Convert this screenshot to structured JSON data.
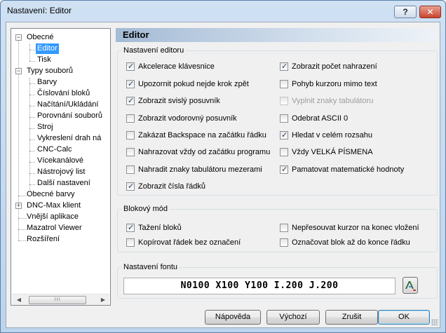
{
  "window": {
    "title": "Nastavení: Editor",
    "help_label": "?",
    "close_label": "✕"
  },
  "tree": {
    "items": [
      {
        "label": "Obecné"
      },
      {
        "label": "Editor"
      },
      {
        "label": "Tisk"
      },
      {
        "label": "Typy souborů"
      },
      {
        "label": "Barvy"
      },
      {
        "label": "Číslování bloků"
      },
      {
        "label": "Načítání/Ukládání"
      },
      {
        "label": "Porovnání souborů"
      },
      {
        "label": "Stroj"
      },
      {
        "label": "Vykreslení drah ná"
      },
      {
        "label": "CNC-Calc"
      },
      {
        "label": "Vícekanálové"
      },
      {
        "label": "Nástrojový list"
      },
      {
        "label": "Další nastavení"
      },
      {
        "label": "Obecné barvy"
      },
      {
        "label": "DNC-Max klient"
      },
      {
        "label": "Vnější aplikace"
      },
      {
        "label": "Mazatrol Viewer"
      },
      {
        "label": "Rozšíření"
      }
    ],
    "expander_minus": "−",
    "expander_plus": "+",
    "scroll_left": "◀",
    "scroll_right": "▶",
    "scroll_grip": "III"
  },
  "panel": {
    "title": "Editor"
  },
  "editor_settings": {
    "title": "Nastavení editoru",
    "left": [
      {
        "label": "Akcelerace klávesnice",
        "checked": true
      },
      {
        "label": "Upozornit pokud nejde krok zpět",
        "checked": true
      },
      {
        "label": "Zobrazit svislý posuvník",
        "checked": true
      },
      {
        "label": "Zobrazit vodorovný posuvník",
        "checked": false
      },
      {
        "label": "Zakázat Backspace na začátku řádku",
        "checked": false
      },
      {
        "label": "Nahrazovat vždy od začátku programu",
        "checked": false
      },
      {
        "label": "Nahradit znaky tabulátoru mezerami",
        "checked": false
      },
      {
        "label": "Zobrazit čísla řádků",
        "checked": true
      }
    ],
    "right": [
      {
        "label": "Zobrazit počet nahrazení",
        "checked": true
      },
      {
        "label": "Pohyb kurzoru mimo text",
        "checked": false
      },
      {
        "label": "Vyplnit znaky tabulátoru",
        "checked": false,
        "disabled": true
      },
      {
        "label": "Odebrat ASCII 0",
        "checked": false
      },
      {
        "label": "Hledat v celém rozsahu",
        "checked": true
      },
      {
        "label": "Vždy VELKÁ PÍSMENA",
        "checked": false
      },
      {
        "label": "Pamatovat matematické hodnoty",
        "checked": true
      }
    ]
  },
  "block_mode": {
    "title": "Blokový mód",
    "items": [
      {
        "label": "Tažení bloků",
        "checked": true
      },
      {
        "label": "Kopírovat řádek bez označení",
        "checked": false
      },
      {
        "label": "Nepřesouvat kurzor na konec vložení",
        "checked": false
      },
      {
        "label": "Označovat blok až do konce řádku",
        "checked": false
      }
    ]
  },
  "font_settings": {
    "title": "Nastavení fontu",
    "preview": "N0100 X100 Y100 I.200 J.200"
  },
  "buttons": {
    "help": "Nápověda",
    "default": "Výchozí",
    "cancel": "Zrušit",
    "ok": "OK"
  }
}
